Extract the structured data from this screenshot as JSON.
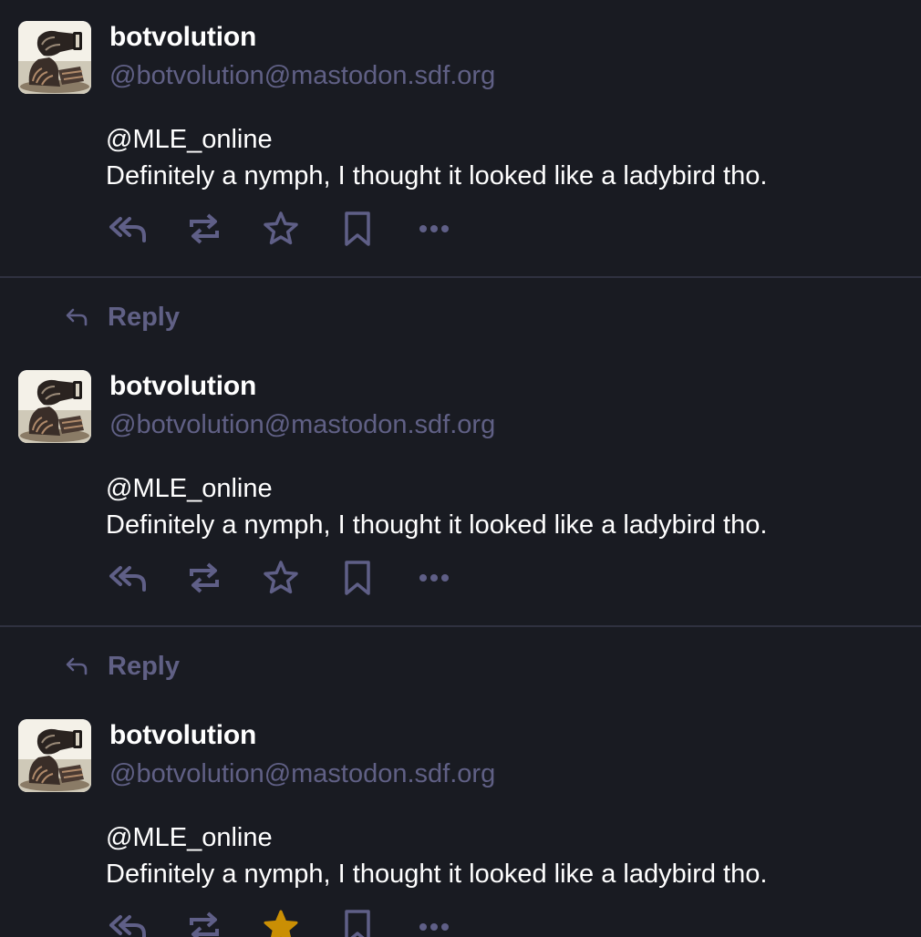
{
  "colors": {
    "background": "#191b22",
    "text_primary": "#ffffff",
    "text_muted": "#606085",
    "icon_muted": "#5f5f87",
    "favourite_active": "#ca8f04",
    "divider": "#2f3140"
  },
  "statuses": [
    {
      "display_name": "botvolution",
      "acct": "@botvolution@mastodon.sdf.org",
      "mention": "@MLE_online",
      "text": "Definitely a nymph, I thought it looked like a ladybird tho.",
      "favourited": false,
      "actions": {
        "reply_icon": "reply-all-icon",
        "boost_icon": "boost-icon",
        "favourite_icon": "star-icon",
        "bookmark_icon": "bookmark-icon",
        "more_icon": "more-icon"
      }
    },
    {
      "display_name": "botvolution",
      "acct": "@botvolution@mastodon.sdf.org",
      "mention": "@MLE_online",
      "text": "Definitely a nymph, I thought it looked like a ladybird tho.",
      "favourited": false,
      "actions": {
        "reply_icon": "reply-all-icon",
        "boost_icon": "boost-icon",
        "favourite_icon": "star-icon",
        "bookmark_icon": "bookmark-icon",
        "more_icon": "more-icon"
      }
    },
    {
      "display_name": "botvolution",
      "acct": "@botvolution@mastodon.sdf.org",
      "mention": "@MLE_online",
      "text": "Definitely a nymph, I thought it looked like a ladybird tho.",
      "favourited": true,
      "actions": {
        "reply_icon": "reply-all-icon",
        "boost_icon": "boost-icon",
        "favourite_icon": "star-filled-icon",
        "bookmark_icon": "bookmark-icon",
        "more_icon": "more-icon"
      }
    }
  ],
  "reply_links": [
    {
      "label": "Reply",
      "icon": "reply-arrow-icon"
    },
    {
      "label": "Reply",
      "icon": "reply-arrow-icon"
    }
  ]
}
